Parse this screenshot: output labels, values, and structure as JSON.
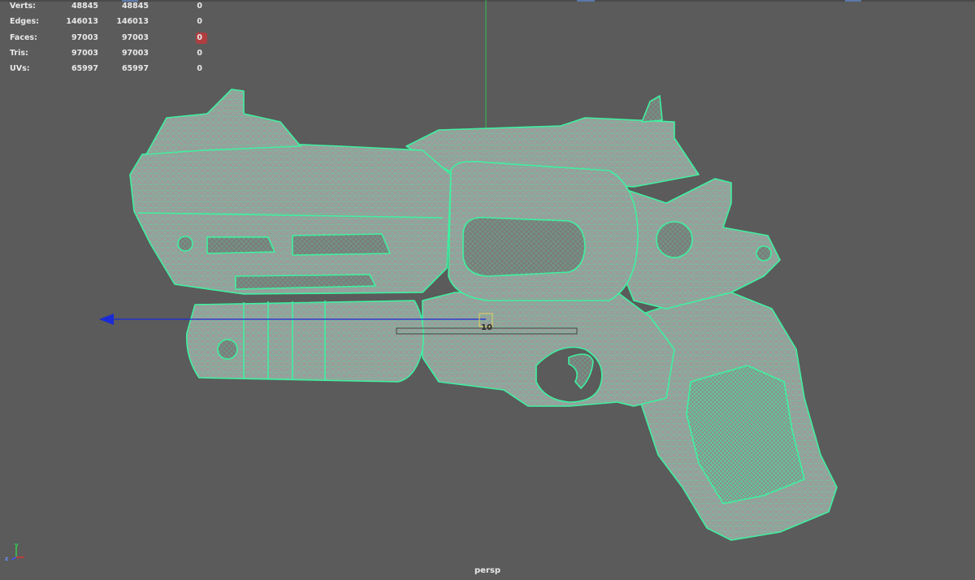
{
  "hud": {
    "rows": [
      {
        "label": "Verts:",
        "v1": "48845",
        "v2": "48845",
        "v3": "0"
      },
      {
        "label": "Edges:",
        "v1": "146013",
        "v2": "146013",
        "v3": "0"
      },
      {
        "label": "Faces:",
        "v1": "97003",
        "v2": "97003",
        "v3": "0"
      },
      {
        "label": "Tris:",
        "v1": "97003",
        "v2": "97003",
        "v3": "0"
      },
      {
        "label": "UVs:",
        "v1": "65997",
        "v2": "65997",
        "v3": "0"
      }
    ]
  },
  "manipulator": {
    "value": "10"
  },
  "axis_gizmo": {
    "y_label": "y",
    "z_label": "z",
    "x_label": "x"
  },
  "viewport": {
    "camera_label": "persp"
  },
  "colors": {
    "background": "#5b5b5b",
    "wireframe": "#3ff0a0",
    "model_fill": "#9d9d9d",
    "grid_green_axis": "#2fc24a",
    "blue_axis": "#1a2bd6",
    "hud_text": "#e8e8e8",
    "warning": "#c0393b"
  },
  "icons": {
    "axis_gizmo": "xyz-axis-icon",
    "warning": "warning-marker-icon"
  }
}
